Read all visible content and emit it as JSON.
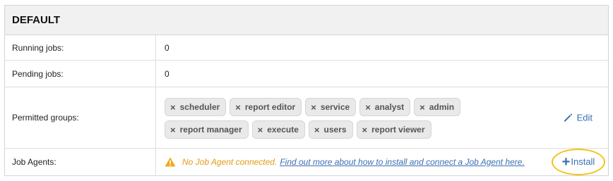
{
  "panel": {
    "title": "DEFAULT"
  },
  "rows": {
    "running_jobs": {
      "label": "Running jobs:",
      "value": "0"
    },
    "pending_jobs": {
      "label": "Pending jobs:",
      "value": "0"
    },
    "permitted_groups": {
      "label": "Permitted groups:",
      "groups": [
        "scheduler",
        "report editor",
        "service",
        "analyst",
        "admin",
        "report manager",
        "execute",
        "users",
        "report viewer"
      ],
      "remove_glyph": "×",
      "edit_label": "Edit"
    },
    "job_agents": {
      "label": "Job Agents:",
      "warning": "No Job Agent connected.",
      "link": "Find out more about how to install and connect a Job Agent here.",
      "install_label": "Install"
    }
  },
  "colors": {
    "accent": "#3a6fb0",
    "warning": "#e59a10",
    "highlight": "#f2c318"
  }
}
